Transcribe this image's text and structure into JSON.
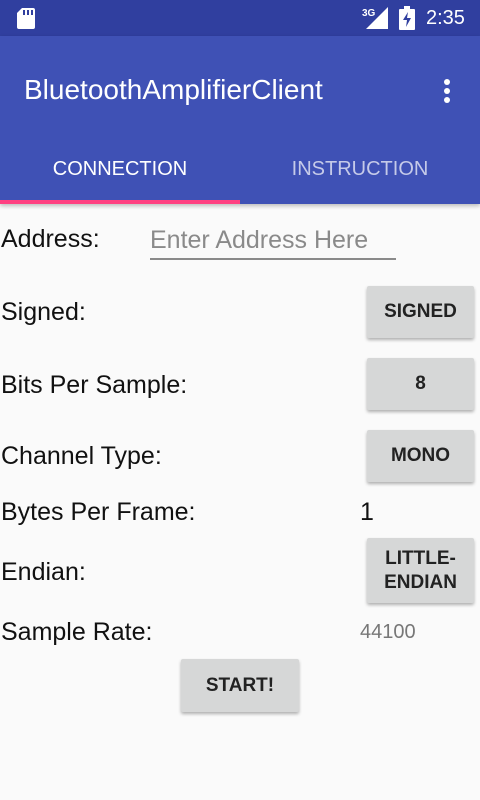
{
  "status_bar": {
    "network_label": "3G",
    "time": "2:35"
  },
  "app_bar": {
    "title": "BluetoothAmplifierClient",
    "overflow_icon": "more-vert-icon"
  },
  "tabs": [
    {
      "label": "CONNECTION",
      "selected": true
    },
    {
      "label": "INSTRUCTION",
      "selected": false
    }
  ],
  "colors": {
    "status_bar": "#303f9f",
    "app_bar": "#3f51b5",
    "tab_indicator": "#ff4081",
    "button": "#d6d7d7"
  },
  "form": {
    "address": {
      "label": "Address:",
      "value": "",
      "placeholder": "Enter Address Here"
    },
    "signed": {
      "label": "Signed:",
      "button": "SIGNED"
    },
    "bits_per_sample": {
      "label": "Bits Per Sample:",
      "button": "8"
    },
    "channel_type": {
      "label": "Channel Type:",
      "button": "MONO"
    },
    "bytes_per_frame": {
      "label": "Bytes Per Frame:",
      "value": "1"
    },
    "endian": {
      "label": "Endian:",
      "button_line1": "LITTLE-",
      "button_line2": "ENDIAN"
    },
    "sample_rate": {
      "label": "Sample Rate:",
      "value": "44100"
    },
    "start_button": "START!"
  }
}
